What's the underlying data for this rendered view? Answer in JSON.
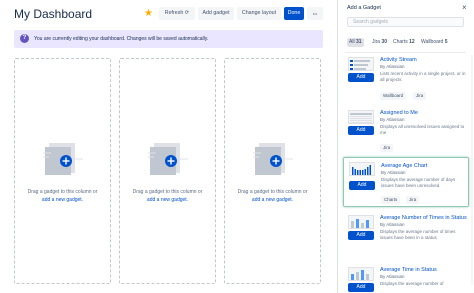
{
  "header": {
    "title": "My Dashboard",
    "refresh_label": "Refresh",
    "add_gadget_label": "Add gadget",
    "change_layout_label": "Change layout",
    "done_label": "Done",
    "more_label": "•••"
  },
  "banner": {
    "icon": "question-icon",
    "text": "You are currently editing your dashboard. Changes will be saved automatically."
  },
  "columns": [
    {
      "text": "Drag a gadget to this column or",
      "link": "add a new gadget."
    },
    {
      "text": "Drag a gadget to this column or",
      "link": "add a new gadget."
    },
    {
      "text": "Drag a gadget to this column or",
      "link": "add a new gadget."
    }
  ],
  "panel": {
    "title": "Add a Gadget",
    "search_placeholder": "Search gadgets",
    "filters": [
      {
        "label": "All",
        "count": "31",
        "active": true
      },
      {
        "label": "Jira",
        "count": "30",
        "active": false
      },
      {
        "label": "Charts",
        "count": "12",
        "active": false
      },
      {
        "label": "Wallboard",
        "count": "5",
        "active": false
      }
    ],
    "add_label": "Add",
    "gadgets": [
      {
        "name": "Activity Stream",
        "by": "By Atlassian",
        "description": "Lists recent activity in a single project, or in all projects",
        "tags": [
          "Wallboard",
          "Jira"
        ]
      },
      {
        "name": "Assigned to Me",
        "by": "By Atlassian",
        "description": "Displays all unresolved issues assigned to me",
        "tags": [
          "Jira"
        ]
      },
      {
        "name": "Average Age Chart",
        "by": "By Atlassian",
        "description": "Displays the average number of days issues have been unresolved.",
        "tags": [
          "Charts",
          "Jira"
        ]
      },
      {
        "name": "Average Number of Times in Status",
        "by": "By Atlassian",
        "description": "Displays the average number of times issues have been in a status",
        "tags": []
      },
      {
        "name": "Average Time in Status",
        "by": "By Atlassian",
        "description": "Displays the average number of",
        "tags": []
      }
    ]
  },
  "colors": {
    "primary": "#0052cc",
    "banner_bg": "#eae6ff",
    "banner_icon": "#6554c0",
    "star": "#ffab00",
    "selected_border": "#8fc9b3"
  }
}
